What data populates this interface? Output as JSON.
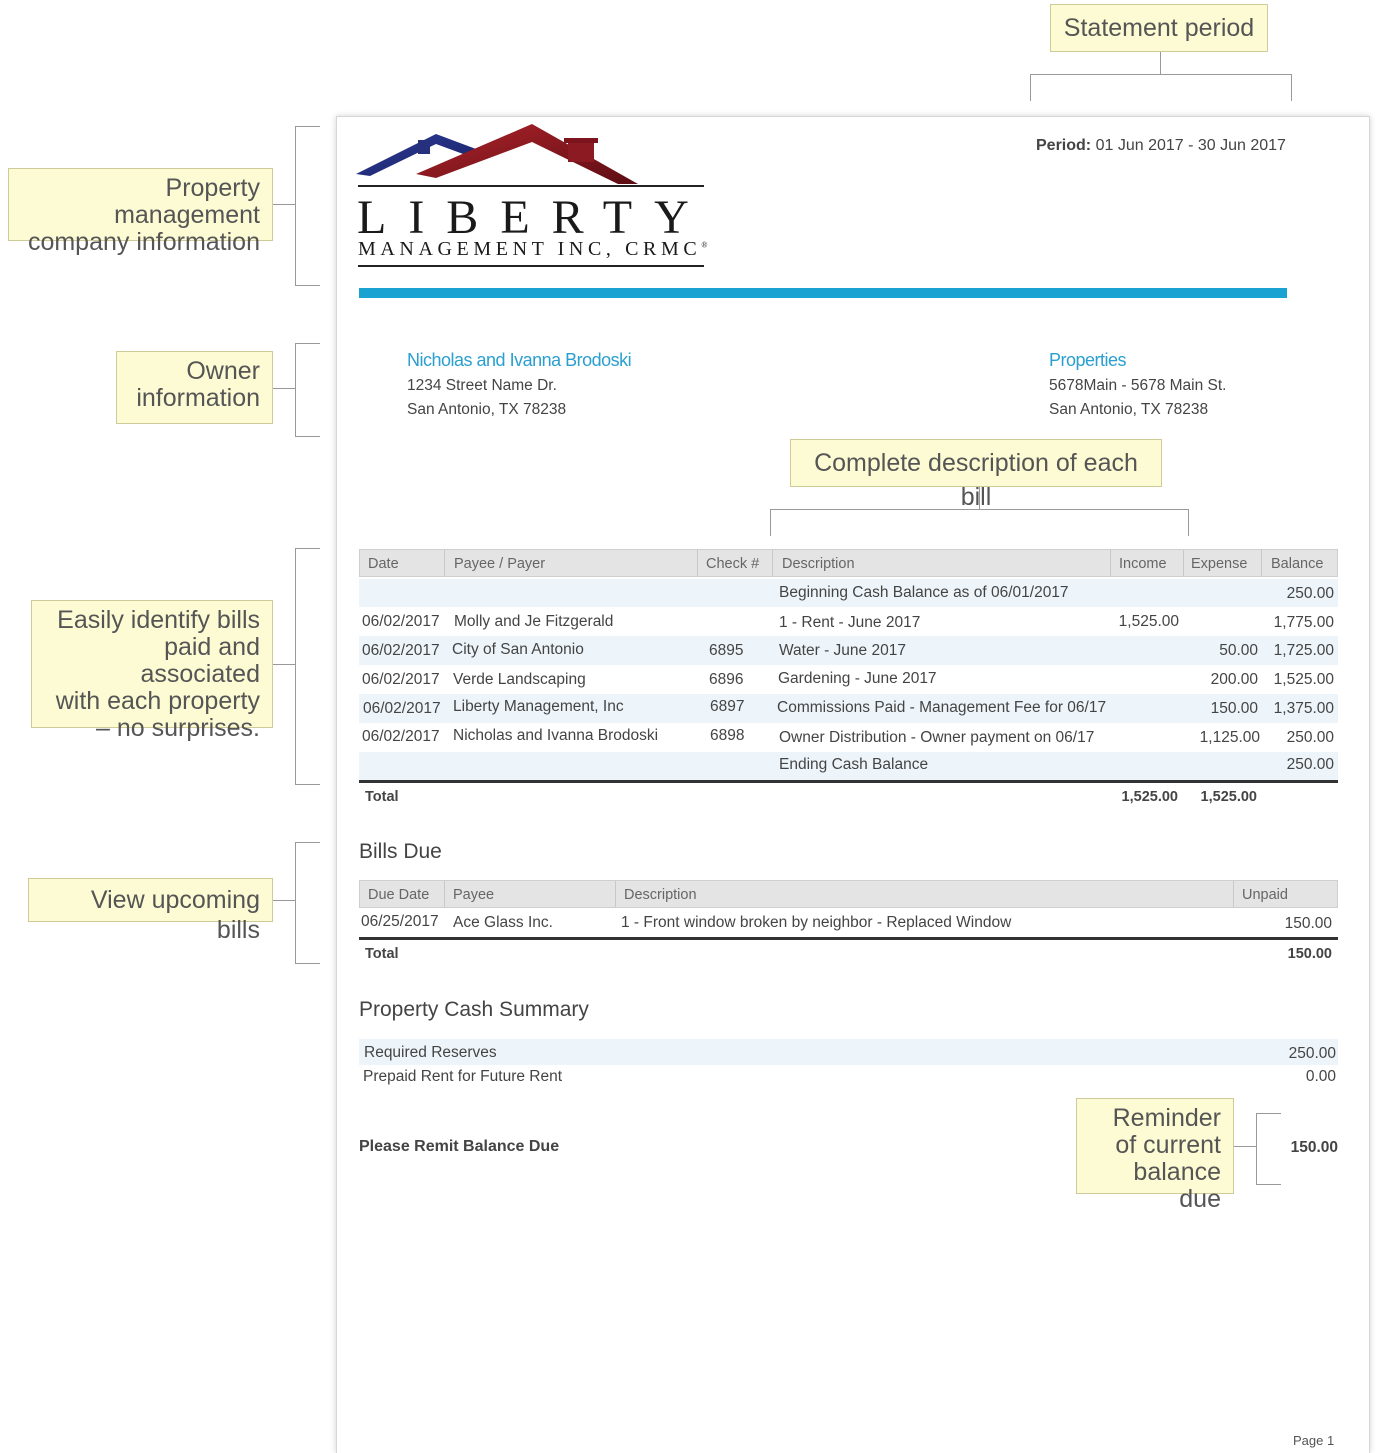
{
  "callouts": {
    "statement_period": "Statement period",
    "company_info": [
      "Property management",
      "company information"
    ],
    "owner_info": [
      "Owner",
      "information"
    ],
    "bill_description": "Complete description of each bill",
    "identify_bills": [
      "Easily identify bills",
      "paid and associated",
      "with each property",
      "– no surprises."
    ],
    "upcoming_bills": "View upcoming bills",
    "reminder": [
      "Reminder",
      "of current",
      "balance due"
    ]
  },
  "colors": {
    "accent_blue": "#1aa2d3",
    "callout_bg": "#fdfbd3",
    "roof_blue": "#2b3a8f",
    "roof_red": "#9b1c24"
  },
  "logo": {
    "word": "LIBERTY",
    "sub": "MANAGEMENT INC, CRMC",
    "mark": "®"
  },
  "period": {
    "label": "Period:",
    "value": "01 Jun 2017 - 30 Jun 2017"
  },
  "owner": {
    "name": "Nicholas and Ivanna Brodoski",
    "line1": "1234 Street Name Dr.",
    "line2": "San Antonio, TX 78238"
  },
  "properties": {
    "heading": "Properties",
    "line1": "5678Main - 5678 Main St.",
    "line2": "San Antonio, TX 78238"
  },
  "ledger": {
    "headers": {
      "date": "Date",
      "payee": "Payee / Payer",
      "check": "Check #",
      "description": "Description",
      "income": "Income",
      "expense": "Expense",
      "balance": "Balance"
    },
    "rows": [
      {
        "date": "",
        "payee": "",
        "check": "",
        "description": "Beginning Cash Balance as of 06/01/2017",
        "income": "",
        "expense": "",
        "balance": "250.00"
      },
      {
        "date": "06/02/2017",
        "payee": "Molly and Je Fitzgerald",
        "check": "",
        "description": "1 - Rent - June 2017",
        "income": "1,525.00",
        "expense": "",
        "balance": "1,775.00"
      },
      {
        "date": "06/02/2017",
        "payee": "City of San Antonio",
        "check": "6895",
        "description": "Water - June 2017",
        "income": "",
        "expense": "50.00",
        "balance": "1,725.00"
      },
      {
        "date": "06/02/2017",
        "payee": "Verde Landscaping",
        "check": "6896",
        "description": "Gardening - June 2017",
        "income": "",
        "expense": "200.00",
        "balance": "1,525.00"
      },
      {
        "date": "06/02/2017",
        "payee": "Liberty Management, Inc",
        "check": "6897",
        "description": "Commissions Paid - Management Fee for 06/17",
        "income": "",
        "expense": "150.00",
        "balance": "1,375.00"
      },
      {
        "date": "06/02/2017",
        "payee": "Nicholas and Ivanna Brodoski",
        "check": "6898",
        "description": "Owner Distribution - Owner payment on 06/17",
        "income": "",
        "expense": "1,125.00",
        "balance": "250.00"
      },
      {
        "date": "",
        "payee": "",
        "check": "",
        "description": "Ending Cash Balance",
        "income": "",
        "expense": "",
        "balance": "250.00"
      }
    ],
    "total": {
      "label": "Total",
      "income": "1,525.00",
      "expense": "1,525.00"
    }
  },
  "bills_due": {
    "title": "Bills Due",
    "headers": {
      "due_date": "Due Date",
      "payee": "Payee",
      "description": "Description",
      "unpaid": "Unpaid"
    },
    "rows": [
      {
        "due_date": "06/25/2017",
        "payee": "Ace Glass Inc.",
        "description": "1 - Front window broken by neighbor - Replaced Window",
        "unpaid": "150.00"
      }
    ],
    "total": {
      "label": "Total",
      "unpaid": "150.00"
    }
  },
  "cash_summary": {
    "title": "Property Cash Summary",
    "rows": [
      {
        "label": "Required Reserves",
        "value": "250.00"
      },
      {
        "label": "Prepaid Rent for Future Rent",
        "value": "0.00"
      }
    ]
  },
  "remit": {
    "label": "Please Remit Balance Due",
    "value": "150.00"
  },
  "footer": {
    "page": "Page 1"
  }
}
